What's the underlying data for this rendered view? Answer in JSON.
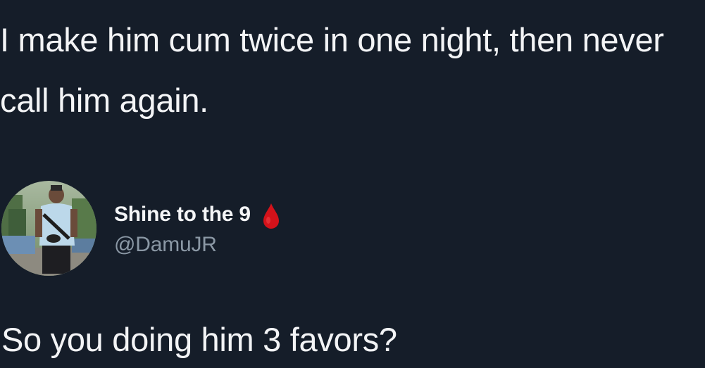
{
  "quoted_tweet": {
    "text": "I make him cum twice in one night, then never call him again."
  },
  "reply": {
    "author": {
      "display_name": "Shine to the 9",
      "handle": "@DamuJR",
      "name_emoji": "drop-of-blood-icon",
      "avatar": "profile-photo-avatar"
    },
    "text": "So you doing him 3 favors?"
  },
  "colors": {
    "background": "#151d29",
    "primary_text": "#f3f4f6",
    "secondary_text": "#8b98a5",
    "emoji_red": "#d3121a"
  }
}
